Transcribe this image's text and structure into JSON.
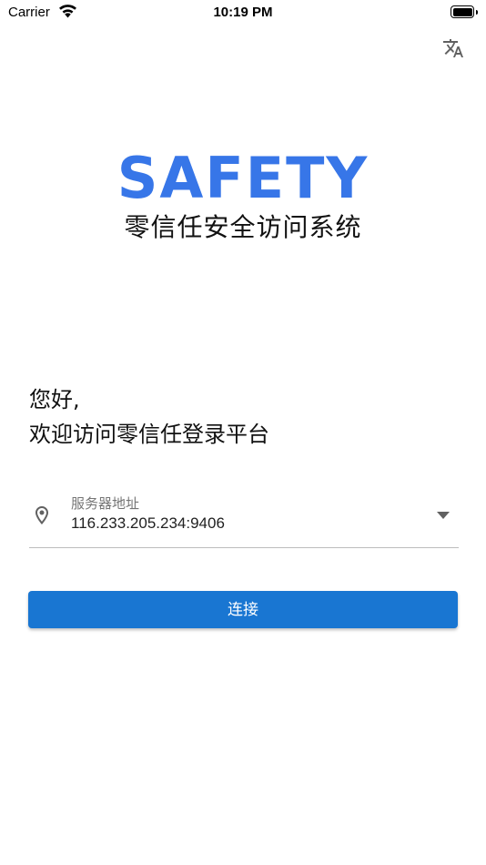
{
  "status_bar": {
    "carrier": "Carrier",
    "time": "10:19 PM",
    "wifi_icon": "wifi-icon",
    "battery_icon": "battery-icon"
  },
  "header": {
    "translate_icon": "translate-icon"
  },
  "brand": {
    "logo_text": "SAFETY",
    "subtitle": "零信任安全访问系统",
    "color": "#3776e8"
  },
  "greeting": {
    "line1": "您好,",
    "line2": "欢迎访问零信任登录平台"
  },
  "server_field": {
    "label": "服务器地址",
    "value": "116.233.205.234:9406",
    "leading_icon": "location-pin-icon",
    "trailing_icon": "dropdown-arrow-icon"
  },
  "connect_button": {
    "label": "连接",
    "color": "#1976d2"
  }
}
